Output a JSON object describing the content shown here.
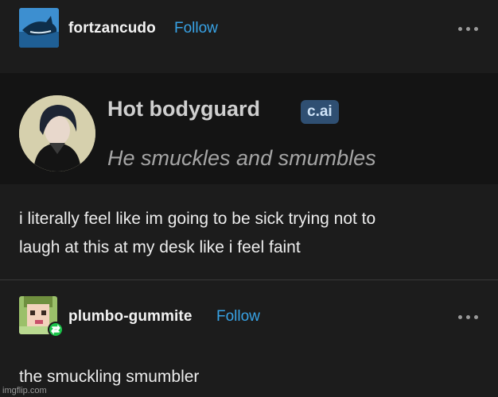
{
  "post1": {
    "username": "fortzancudo",
    "follow_label": "Follow",
    "avatar_icon": "shark-avatar-icon",
    "card": {
      "name": "Hot bodyguard",
      "badge": "c.ai",
      "tagline": "He smuckles and smumbles"
    },
    "text_lines": [
      "i literally feel like im going to be sick trying not to",
      "laugh at this at my desk like i feel faint"
    ]
  },
  "post2": {
    "username": "plumbo-gummite",
    "follow_label": "Follow",
    "avatar_icon": "pixel-girl-avatar-icon",
    "reblog_icon": "reblog-icon",
    "text": "the smuckling smumbler"
  },
  "watermark": "imgflip.com",
  "colors": {
    "background": "#1c1c1c",
    "follow": "#38a3e6",
    "reblog": "#1bc44a",
    "badge": "#2f4f72"
  }
}
